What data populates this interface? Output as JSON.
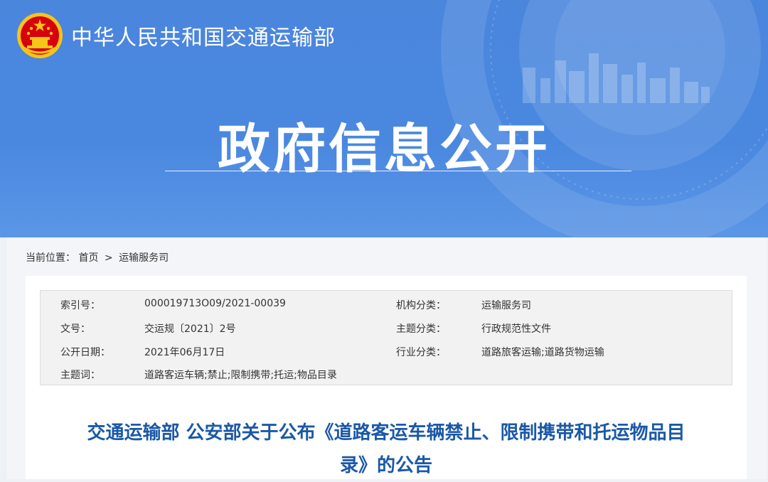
{
  "header": {
    "site_name": "中华人民共和国交通运输部",
    "banner_title": "政府信息公开",
    "colors": {
      "banner": "#4a88e0",
      "title": "#1a58a7",
      "emblem_red": "#d7000f",
      "emblem_gold": "#f5c518"
    }
  },
  "breadcrumb": {
    "label": "当前位置：",
    "items": [
      "首页",
      "运输服务司"
    ],
    "separator": ">"
  },
  "meta": {
    "rows": [
      {
        "label": "索引号：",
        "value": "000019713O09/2021-00039",
        "label2": "机构分类：",
        "value2": "运输服务司"
      },
      {
        "label": "文号：",
        "value": "交运规〔2021〕2号",
        "label2": "主题分类：",
        "value2": "行政规范性文件"
      },
      {
        "label": "公开日期：",
        "value": "2021年06月17日",
        "label2": "行业分类：",
        "value2": "道路旅客运输;道路货物运输"
      },
      {
        "label": "主题词：",
        "value": "道路客运车辆;禁止;限制携带;托运;物品目录"
      }
    ]
  },
  "article": {
    "title_line1": "交通运输部 公安部关于公布《道路客运车辆禁止、限制携带和托运物品目",
    "title_line2": "录》的公告"
  }
}
